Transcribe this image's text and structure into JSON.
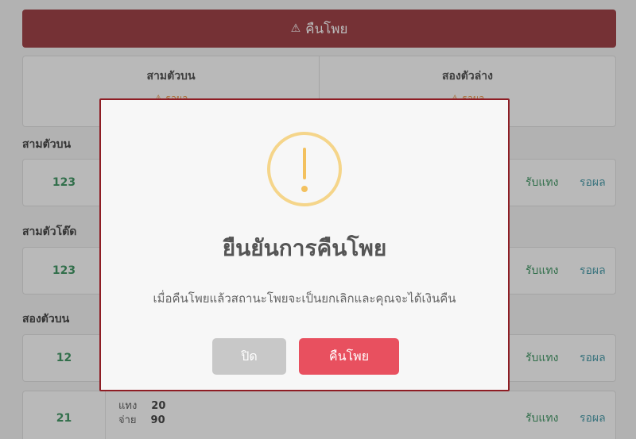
{
  "page": {
    "refund_button": "คืนโพย",
    "refund_icon": "warning-triangle-icon"
  },
  "results": [
    {
      "title": "สามตัวบน",
      "status": "รอผล"
    },
    {
      "title": "สองตัวล่าง",
      "status": "รอผล"
    }
  ],
  "sections": {
    "three_top": "สามตัวบน",
    "three_tod": "สามตัวโต๊ด",
    "two_top": "สองตัวบน"
  },
  "rows": [
    {
      "number": "123",
      "accept": "รับแทง",
      "status": "รอผล"
    },
    {
      "number": "123",
      "accept": "รับแทง",
      "status": "รอผล"
    },
    {
      "number": "12",
      "accept": "รับแทง",
      "status": "รอผล"
    },
    {
      "number": "21",
      "accept": "รับแทง",
      "status": "รอผล",
      "bet_label": "แทง",
      "bet_value": "20",
      "pay_label": "จ่าย",
      "pay_value": "90"
    }
  ],
  "modal": {
    "icon": "warning-circle-icon",
    "title": "ยืนยันการคืนโพย",
    "text": "เมื่อคืนโพยแล้วสถานะโพยจะเป็นยกเลิกและคุณจะได้เงินคืน",
    "close_label": "ปิด",
    "confirm_label": "คืนโพย"
  },
  "colors": {
    "brand": "#8e1d24",
    "confirm": "#e8505f",
    "close": "#c8c8c8",
    "warning": "#f3c15f",
    "number": "#1e8449",
    "status": "#2a8b9c"
  }
}
